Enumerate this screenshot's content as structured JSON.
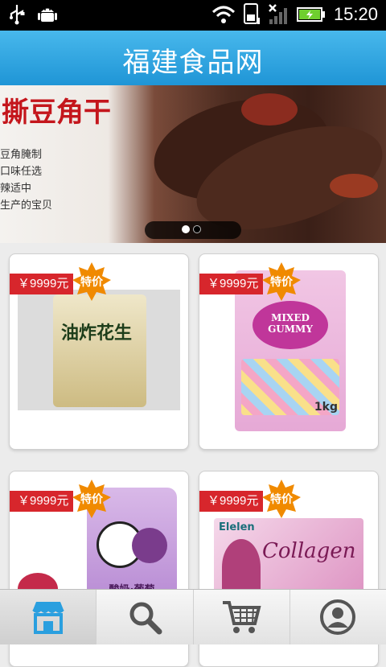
{
  "status": {
    "time": "15:20"
  },
  "header": {
    "title": "福建食品网"
  },
  "banner": {
    "title": "撕豆角干",
    "lines": [
      "豆角腌制",
      "口味任选",
      "辣适中",
      "生产的宝贝"
    ],
    "active_dot": 0
  },
  "products": [
    {
      "price": "￥9999元",
      "badge": "特价",
      "image_text": "油炸花生"
    },
    {
      "price": "￥9999元",
      "badge": "特价",
      "image_text": "MIXED GUMMY",
      "image_sub": "1kg"
    },
    {
      "price": "￥9999元",
      "badge": "特价",
      "image_text": "酸奶·葡萄"
    },
    {
      "price": "￥9999元",
      "badge": "特价",
      "image_text": "Collagen",
      "image_brand": "Elelen"
    }
  ],
  "nav": {
    "tabs": [
      "store-icon",
      "search-icon",
      "cart-icon",
      "profile-icon"
    ],
    "active": 0
  },
  "colors": {
    "accent": "#2a9fdf",
    "price": "#d7262c",
    "badge": "#f08a00"
  }
}
